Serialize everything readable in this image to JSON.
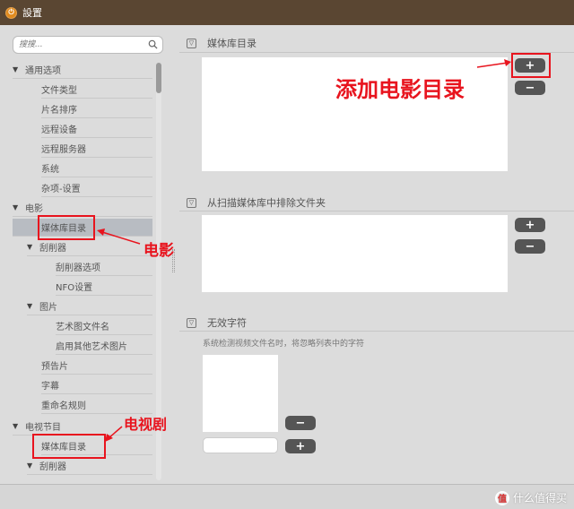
{
  "window": {
    "title": "設置"
  },
  "search": {
    "placeholder": "搜搜..."
  },
  "tree": [
    {
      "label": "通用选项",
      "caret": "▼"
    },
    {
      "label": "文件类型"
    },
    {
      "label": "片名排序"
    },
    {
      "label": "远程设备"
    },
    {
      "label": "远程服务器"
    },
    {
      "label": "系统"
    },
    {
      "label": "杂项-设置"
    },
    {
      "label": "电影",
      "caret": "▼"
    },
    {
      "label": "媒体库目录"
    },
    {
      "label": "刮削器",
      "caret": "▼"
    },
    {
      "label": "刮削器选项"
    },
    {
      "label": "NFO设置"
    },
    {
      "label": "图片",
      "caret": "▼"
    },
    {
      "label": "艺术图文件名"
    },
    {
      "label": "启用其他艺术图片"
    },
    {
      "label": "预告片"
    },
    {
      "label": "字幕"
    },
    {
      "label": "重命名规则"
    },
    {
      "label": "电视节目",
      "caret": "▼"
    },
    {
      "label": "媒体库目录"
    },
    {
      "label": "刮削器",
      "caret": "▼"
    }
  ],
  "sections": {
    "library": {
      "title": "媒体库目录",
      "collapse": "▽"
    },
    "exclude": {
      "title": "从扫描媒体库中排除文件夹",
      "collapse": "▽"
    },
    "invalid": {
      "title": "无效字符",
      "collapse": "▽",
      "hint": "系统检测视频文件名时，将忽略列表中的字符"
    }
  },
  "buttons": {
    "add": "+",
    "remove": "−"
  },
  "annotations": {
    "add_movie_dir": "添加电影目录",
    "movie": "电影",
    "tv": "电视剧"
  },
  "watermark": {
    "badge": "值",
    "text": "什么值得买"
  },
  "colors": {
    "titlebar": "#5a4632",
    "annotation": "#e8141e",
    "button": "#555555"
  }
}
